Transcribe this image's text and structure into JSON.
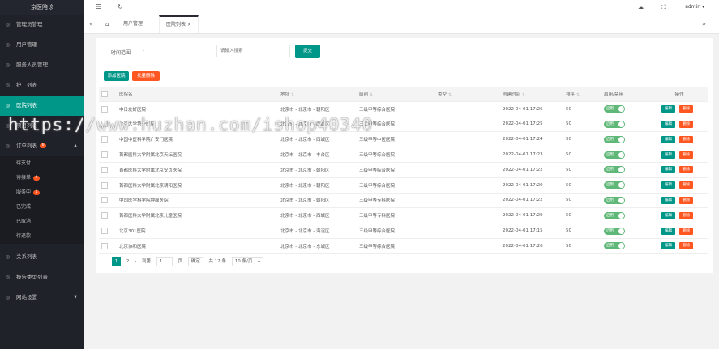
{
  "sidebar": {
    "logo": "京医陪诊",
    "items": [
      {
        "label": "管理员管理",
        "icon": "admin-icon"
      },
      {
        "label": "用户管理",
        "icon": "user-icon"
      },
      {
        "label": "服务人员管理",
        "icon": "staff-icon"
      },
      {
        "label": "护工列表",
        "icon": "list-icon"
      },
      {
        "label": "医院列表",
        "icon": "hospital-icon",
        "active": true
      },
      {
        "label": "项目列表",
        "icon": "project-icon"
      }
    ],
    "orders": {
      "label": "订单列表",
      "badge": "6",
      "icon": "order-icon",
      "subitems": [
        {
          "label": "待支付",
          "badge": ""
        },
        {
          "label": "待接单",
          "badge": "2"
        },
        {
          "label": "服务中",
          "badge": "1"
        },
        {
          "label": "已完成",
          "badge": ""
        },
        {
          "label": "已取消",
          "badge": ""
        },
        {
          "label": "待退款",
          "badge": ""
        }
      ]
    },
    "bottom": [
      {
        "label": "关系列表",
        "icon": "relation-icon"
      },
      {
        "label": "报告类型列表",
        "icon": "report-icon"
      },
      {
        "label": "网站设置",
        "icon": "settings-icon"
      }
    ]
  },
  "topbar": {
    "user": "admin"
  },
  "tabs": [
    "用户管理",
    "医院列表"
  ],
  "filter": {
    "time_label": "时间范围",
    "time_placeholder": "-",
    "keyword_placeholder": "请输入搜索",
    "submit": "提交"
  },
  "actions": {
    "add": "添加医院",
    "batch_delete": "批量删除"
  },
  "table": {
    "headers": [
      "医院名",
      "地址",
      "级别",
      "类型",
      "创建时间",
      "排序",
      "启用/禁用",
      "操作"
    ],
    "switch_label": "启用",
    "edit_label": "编辑",
    "delete_label": "删除",
    "rows": [
      {
        "name": "中日友好医院",
        "address": "北京市 - 北京市 - 朝阳区",
        "level": "三级甲等综合医院",
        "type": "",
        "created": "2022-04-01 17:26",
        "sort": "50"
      },
      {
        "name": "北京大学第一医院",
        "address": "北京市 - 北京市 - 西城区",
        "level": "三级甲等综合医院",
        "type": "",
        "created": "2022-04-01 17:25",
        "sort": "50"
      },
      {
        "name": "中国中医科学院广安门医院",
        "address": "北京市 - 北京市 - 西城区",
        "level": "三级甲等中医医院",
        "type": "",
        "created": "2022-04-01 17:24",
        "sort": "50"
      },
      {
        "name": "首都医科大学附属北京天坛医院",
        "address": "北京市 - 北京市 - 丰台区",
        "level": "三级甲等综合医院",
        "type": "",
        "created": "2022-04-01 17:23",
        "sort": "50"
      },
      {
        "name": "首都医科大学附属北京安贞医院",
        "address": "北京市 - 北京市 - 朝阳区",
        "level": "三级甲等综合医院",
        "type": "",
        "created": "2022-04-01 17:22",
        "sort": "50"
      },
      {
        "name": "首都医科大学附属北京朝阳医院",
        "address": "北京市 - 北京市 - 朝阳区",
        "level": "三级甲等综合医院",
        "type": "",
        "created": "2022-04-01 17:20",
        "sort": "50"
      },
      {
        "name": "中国医学科学院肿瘤医院",
        "address": "北京市 - 北京市 - 朝阳区",
        "level": "三级甲等专科医院",
        "type": "",
        "created": "2022-04-01 17:22",
        "sort": "50"
      },
      {
        "name": "首都医科大学附属北京儿童医院",
        "address": "北京市 - 北京市 - 西城区",
        "level": "三级甲等专科医院",
        "type": "",
        "created": "2022-04-01 17:20",
        "sort": "50"
      },
      {
        "name": "北京301医院",
        "address": "北京市 - 北京市 - 海淀区",
        "level": "三级甲等综合医院",
        "type": "",
        "created": "2022-04-01 17:15",
        "sort": "50"
      },
      {
        "name": "北京协和医院",
        "address": "北京市 - 北京市 - 东城区",
        "level": "三级甲等综合医院",
        "type": "",
        "created": "2022-04-01 17:26",
        "sort": "50"
      }
    ]
  },
  "pagination": {
    "current": "1",
    "next": "2",
    "goto_label": "到第",
    "goto_value": "1",
    "page_unit": "页",
    "confirm": "确定",
    "total": "共 12 条",
    "per_page": "10 条/页"
  },
  "watermark": "https://www.huzhan.com/ishop40340"
}
